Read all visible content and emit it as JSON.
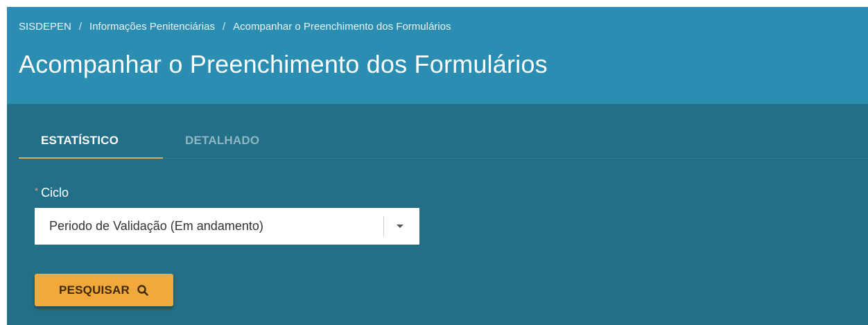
{
  "breadcrumb": {
    "items": [
      "SISDEPEN",
      "Informações Penitenciárias",
      "Acompanhar o Preenchimento dos Formulários"
    ],
    "separator": "/"
  },
  "page": {
    "title": "Acompanhar o Preenchimento dos Formulários"
  },
  "tabs": [
    {
      "label": "ESTATÍSTICO",
      "active": true
    },
    {
      "label": "DETALHADO",
      "active": false
    }
  ],
  "form": {
    "ciclo": {
      "required_marker": "*",
      "label": "Ciclo",
      "selected": "Periodo de Validação (Em andamento)",
      "icon": "caret-down-icon"
    },
    "search_button": {
      "label": "PESQUISAR",
      "icon": "search-icon"
    }
  },
  "colors": {
    "header_bg": "#2a8db1",
    "body_bg": "#236f87",
    "tab_active_underline": "#d6b05a",
    "button_bg": "#f2a93b",
    "required_marker": "#f0a08a"
  }
}
